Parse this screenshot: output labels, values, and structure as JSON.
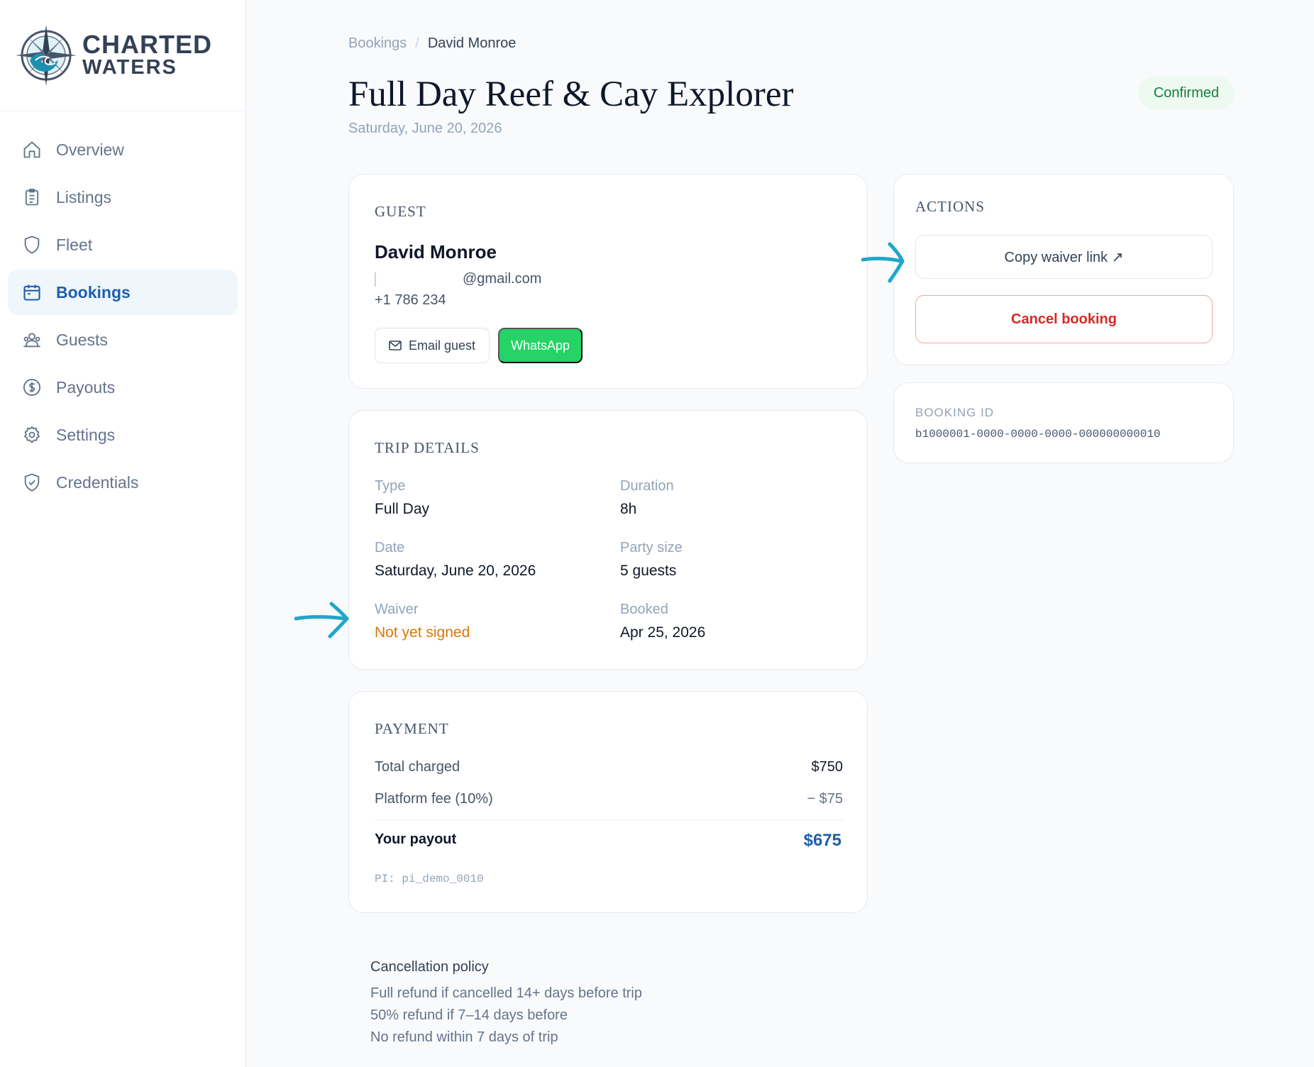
{
  "brand": {
    "line1": "CHARTED",
    "line2": "WATERS"
  },
  "sidebar": {
    "items": [
      {
        "label": "Overview",
        "icon": "home-icon"
      },
      {
        "label": "Listings",
        "icon": "clipboard-icon"
      },
      {
        "label": "Fleet",
        "icon": "shield-icon"
      },
      {
        "label": "Bookings",
        "icon": "calendar-icon",
        "active": true
      },
      {
        "label": "Guests",
        "icon": "users-icon"
      },
      {
        "label": "Payouts",
        "icon": "dollar-circle-icon"
      },
      {
        "label": "Settings",
        "icon": "gear-icon"
      },
      {
        "label": "Credentials",
        "icon": "shield-check-icon"
      }
    ]
  },
  "breadcrumb": {
    "parent": "Bookings",
    "separator": "/",
    "current": "David Monroe"
  },
  "header": {
    "title": "Full Day Reef & Cay Explorer",
    "subtitle": "Saturday, June 20, 2026",
    "status": "Confirmed"
  },
  "guest": {
    "heading": "GUEST",
    "name": "David Monroe",
    "email_suffix": "@gmail.com",
    "phone": "+1 786 234",
    "email_button": "Email guest",
    "whatsapp_button": "WhatsApp"
  },
  "trip": {
    "heading": "TRIP DETAILS",
    "type_label": "Type",
    "type_value": "Full Day",
    "duration_label": "Duration",
    "duration_value": "8h",
    "date_label": "Date",
    "date_value": "Saturday, June 20, 2026",
    "party_label": "Party size",
    "party_value": "5 guests",
    "waiver_label": "Waiver",
    "waiver_value": "Not yet signed",
    "booked_label": "Booked",
    "booked_value": "Apr 25, 2026"
  },
  "payment": {
    "heading": "PAYMENT",
    "total_label": "Total charged",
    "total_value": "$750",
    "fee_label": "Platform fee (10%)",
    "fee_value": "− $75",
    "payout_label": "Your payout",
    "payout_value": "$675",
    "pi": "PI: pi_demo_0010"
  },
  "cancellation": {
    "title": "Cancellation policy",
    "lines": [
      "Full refund if cancelled 14+ days before trip",
      "50% refund if 7–14 days before",
      "No refund within 7 days of trip"
    ]
  },
  "actions": {
    "heading": "ACTIONS",
    "copy_waiver": "Copy waiver link ↗",
    "cancel_booking": "Cancel booking"
  },
  "booking_id": {
    "label": "BOOKING ID",
    "value": "b1000001-0000-0000-0000-000000000010"
  },
  "colors": {
    "accent": "#1d5fad",
    "confirmed": "#15803d",
    "warning": "#d97706",
    "danger": "#dc2626",
    "whatsapp": "#25d366",
    "annotation_arrow": "#1fa6c9"
  }
}
